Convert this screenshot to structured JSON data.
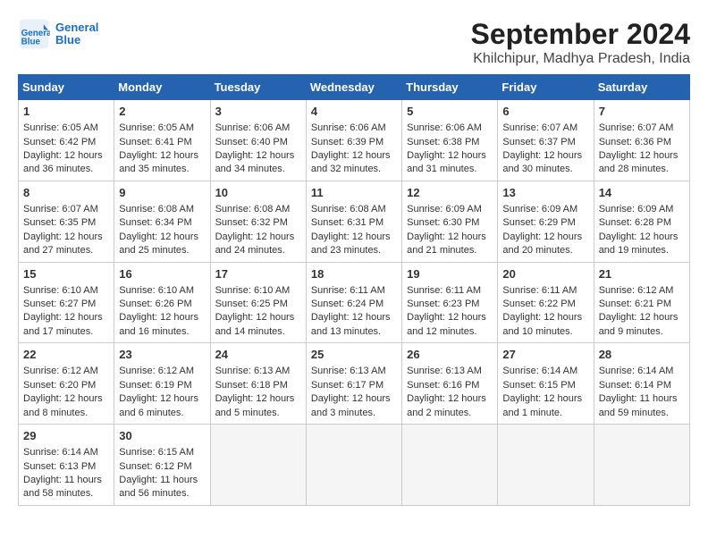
{
  "logo": {
    "line1": "General",
    "line2": "Blue"
  },
  "title": "September 2024",
  "subtitle": "Khilchipur, Madhya Pradesh, India",
  "days": [
    "Sunday",
    "Monday",
    "Tuesday",
    "Wednesday",
    "Thursday",
    "Friday",
    "Saturday"
  ],
  "weeks": [
    [
      {
        "day": 1,
        "sunrise": "6:05 AM",
        "sunset": "6:42 PM",
        "daylight": "12 hours and 36 minutes."
      },
      {
        "day": 2,
        "sunrise": "6:05 AM",
        "sunset": "6:41 PM",
        "daylight": "12 hours and 35 minutes."
      },
      {
        "day": 3,
        "sunrise": "6:06 AM",
        "sunset": "6:40 PM",
        "daylight": "12 hours and 34 minutes."
      },
      {
        "day": 4,
        "sunrise": "6:06 AM",
        "sunset": "6:39 PM",
        "daylight": "12 hours and 32 minutes."
      },
      {
        "day": 5,
        "sunrise": "6:06 AM",
        "sunset": "6:38 PM",
        "daylight": "12 hours and 31 minutes."
      },
      {
        "day": 6,
        "sunrise": "6:07 AM",
        "sunset": "6:37 PM",
        "daylight": "12 hours and 30 minutes."
      },
      {
        "day": 7,
        "sunrise": "6:07 AM",
        "sunset": "6:36 PM",
        "daylight": "12 hours and 28 minutes."
      }
    ],
    [
      {
        "day": 8,
        "sunrise": "6:07 AM",
        "sunset": "6:35 PM",
        "daylight": "12 hours and 27 minutes."
      },
      {
        "day": 9,
        "sunrise": "6:08 AM",
        "sunset": "6:34 PM",
        "daylight": "12 hours and 25 minutes."
      },
      {
        "day": 10,
        "sunrise": "6:08 AM",
        "sunset": "6:32 PM",
        "daylight": "12 hours and 24 minutes."
      },
      {
        "day": 11,
        "sunrise": "6:08 AM",
        "sunset": "6:31 PM",
        "daylight": "12 hours and 23 minutes."
      },
      {
        "day": 12,
        "sunrise": "6:09 AM",
        "sunset": "6:30 PM",
        "daylight": "12 hours and 21 minutes."
      },
      {
        "day": 13,
        "sunrise": "6:09 AM",
        "sunset": "6:29 PM",
        "daylight": "12 hours and 20 minutes."
      },
      {
        "day": 14,
        "sunrise": "6:09 AM",
        "sunset": "6:28 PM",
        "daylight": "12 hours and 19 minutes."
      }
    ],
    [
      {
        "day": 15,
        "sunrise": "6:10 AM",
        "sunset": "6:27 PM",
        "daylight": "12 hours and 17 minutes."
      },
      {
        "day": 16,
        "sunrise": "6:10 AM",
        "sunset": "6:26 PM",
        "daylight": "12 hours and 16 minutes."
      },
      {
        "day": 17,
        "sunrise": "6:10 AM",
        "sunset": "6:25 PM",
        "daylight": "12 hours and 14 minutes."
      },
      {
        "day": 18,
        "sunrise": "6:11 AM",
        "sunset": "6:24 PM",
        "daylight": "12 hours and 13 minutes."
      },
      {
        "day": 19,
        "sunrise": "6:11 AM",
        "sunset": "6:23 PM",
        "daylight": "12 hours and 12 minutes."
      },
      {
        "day": 20,
        "sunrise": "6:11 AM",
        "sunset": "6:22 PM",
        "daylight": "12 hours and 10 minutes."
      },
      {
        "day": 21,
        "sunrise": "6:12 AM",
        "sunset": "6:21 PM",
        "daylight": "12 hours and 9 minutes."
      }
    ],
    [
      {
        "day": 22,
        "sunrise": "6:12 AM",
        "sunset": "6:20 PM",
        "daylight": "12 hours and 8 minutes."
      },
      {
        "day": 23,
        "sunrise": "6:12 AM",
        "sunset": "6:19 PM",
        "daylight": "12 hours and 6 minutes."
      },
      {
        "day": 24,
        "sunrise": "6:13 AM",
        "sunset": "6:18 PM",
        "daylight": "12 hours and 5 minutes."
      },
      {
        "day": 25,
        "sunrise": "6:13 AM",
        "sunset": "6:17 PM",
        "daylight": "12 hours and 3 minutes."
      },
      {
        "day": 26,
        "sunrise": "6:13 AM",
        "sunset": "6:16 PM",
        "daylight": "12 hours and 2 minutes."
      },
      {
        "day": 27,
        "sunrise": "6:14 AM",
        "sunset": "6:15 PM",
        "daylight": "12 hours and 1 minute."
      },
      {
        "day": 28,
        "sunrise": "6:14 AM",
        "sunset": "6:14 PM",
        "daylight": "11 hours and 59 minutes."
      }
    ],
    [
      {
        "day": 29,
        "sunrise": "6:14 AM",
        "sunset": "6:13 PM",
        "daylight": "11 hours and 58 minutes."
      },
      {
        "day": 30,
        "sunrise": "6:15 AM",
        "sunset": "6:12 PM",
        "daylight": "11 hours and 56 minutes."
      },
      null,
      null,
      null,
      null,
      null
    ]
  ]
}
